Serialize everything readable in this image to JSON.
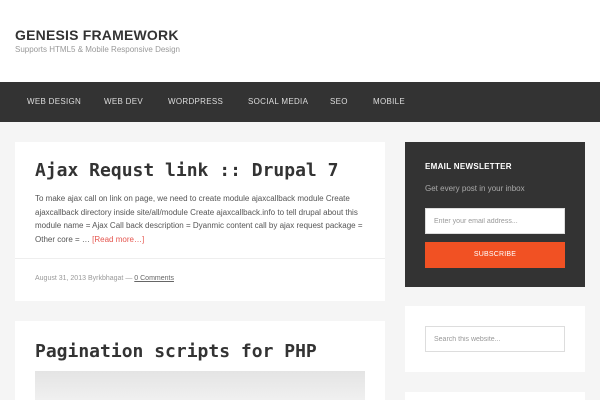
{
  "header": {
    "title": "GENESIS FRAMEWORK",
    "description": "Supports HTML5 & Mobile Responsive Design"
  },
  "nav": {
    "items": [
      {
        "label": "WEB DESIGN"
      },
      {
        "label": "WEB DEV"
      },
      {
        "label": "WORDPRESS"
      },
      {
        "label": "SOCIAL MEDIA"
      },
      {
        "label": "SEO"
      },
      {
        "label": "MOBILE"
      }
    ]
  },
  "posts": [
    {
      "title": "Ajax Requst link :: Drupal 7",
      "excerpt": "To make ajax call on link on page, we need to create module ajaxcallback module Create ajaxcallback directory inside site/all/module Create ajaxcallback.info to tell drupal about this module name = Ajax Call back description = Dyanmic content call by ajax request package = Other core = …",
      "read_more": "[Read more…]",
      "date": "August 31, 2013",
      "by": "By",
      "author": "rkbhagat",
      "sep": "—",
      "comments": "0 Comments"
    },
    {
      "title": "Pagination scripts for PHP"
    }
  ],
  "sidebar": {
    "newsletter": {
      "title": "EMAIL NEWSLETTER",
      "subtitle": "Get every post in your inbox",
      "email_placeholder": "Enter your email address...",
      "button": "SUBSCRIBE"
    },
    "search": {
      "placeholder": "Search this website..."
    }
  },
  "colors": {
    "accent": "#f15123",
    "nav_bg": "#333333",
    "link": "#e5554e"
  }
}
